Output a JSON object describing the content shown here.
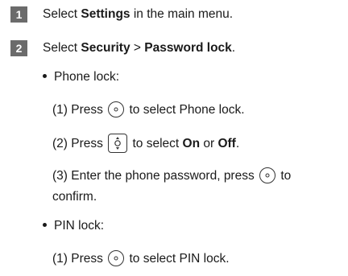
{
  "steps": [
    {
      "number": "1",
      "pre": "Select ",
      "bold1": "Settings",
      "post": " in the main menu."
    },
    {
      "number": "2",
      "pre": "Select ",
      "bold1": "Security",
      "mid": " > ",
      "bold2": "Password lock",
      "post": "."
    }
  ],
  "phone_lock": {
    "heading": "Phone lock:",
    "item1": {
      "pre": "(1) Press ",
      "icon": "ok-key-icon",
      "post": " to select Phone lock."
    },
    "item2": {
      "pre": "(2) Press ",
      "icon": "navigation-key-icon",
      "mid": " to select ",
      "on": "On",
      "or": " or ",
      "off": "Off",
      "post": "."
    },
    "item3": {
      "line1_pre": "(3) Enter the phone password,  press ",
      "icon": "ok-key-icon",
      "line1_post": " to",
      "line2": "confirm."
    }
  },
  "pin_lock": {
    "heading": "PIN lock:",
    "item1": {
      "pre": "(1) Press ",
      "icon": "ok-key-icon",
      "post": " to select PIN lock."
    }
  },
  "colors": {
    "badge": "#6b6b6b",
    "text": "#1a1a1a"
  }
}
